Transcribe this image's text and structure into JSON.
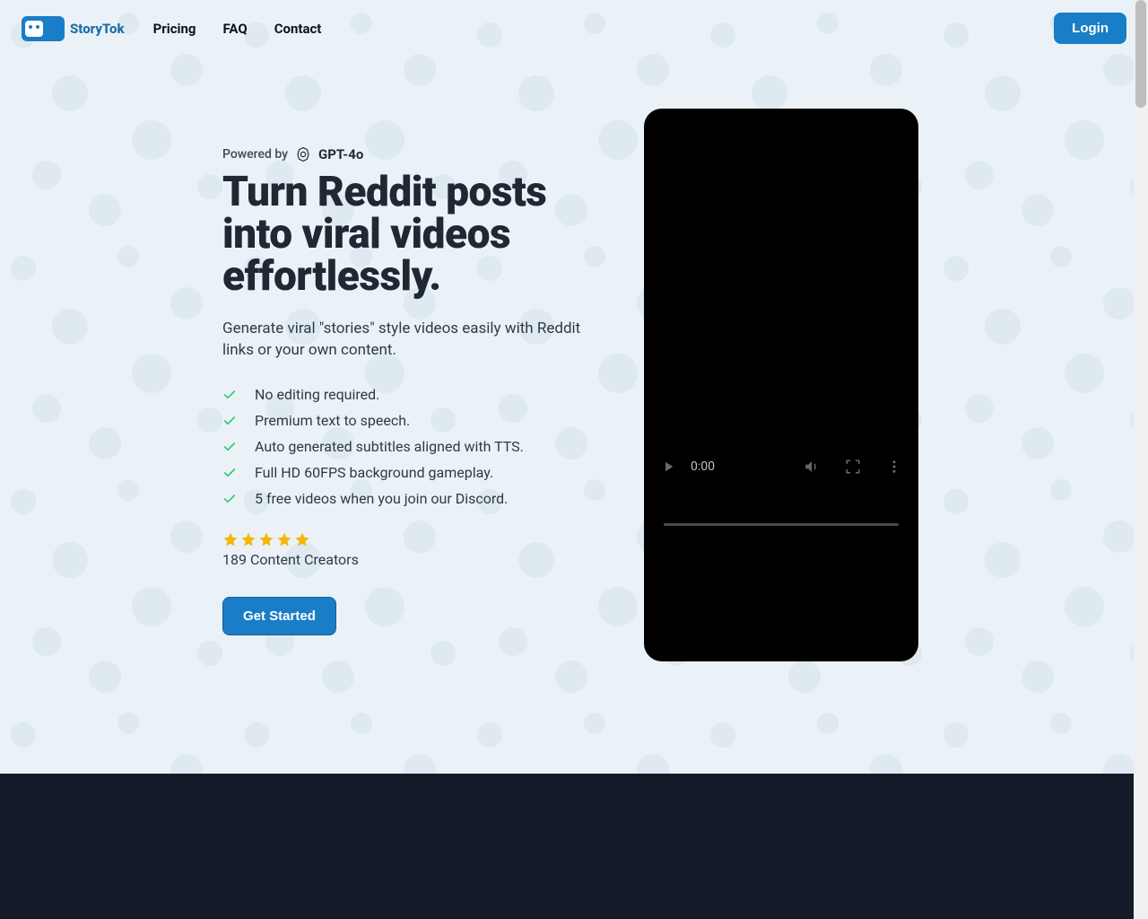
{
  "brand": {
    "name": "StoryTok"
  },
  "nav": {
    "links": [
      {
        "label": "Pricing"
      },
      {
        "label": "FAQ"
      },
      {
        "label": "Contact"
      }
    ],
    "login": "Login"
  },
  "hero": {
    "powered_by": "Powered by",
    "model": "GPT-4o",
    "headline": "Turn Reddit posts into viral videos effortlessly.",
    "subhead": "Generate viral \"stories\" style videos easily with Reddit links or your own content.",
    "features": [
      "No editing required.",
      "Premium text to speech.",
      "Auto generated subtitles aligned with TTS.",
      "Full HD 60FPS background gameplay.",
      "5 free videos when you join our Discord."
    ],
    "creators": "189 Content Creators",
    "cta": "Get Started"
  },
  "video": {
    "time": "0:00"
  },
  "colors": {
    "accent": "#1a7dc7",
    "star": "#f5b50a",
    "check": "#2ecc71",
    "dark_bg": "#141a28"
  }
}
